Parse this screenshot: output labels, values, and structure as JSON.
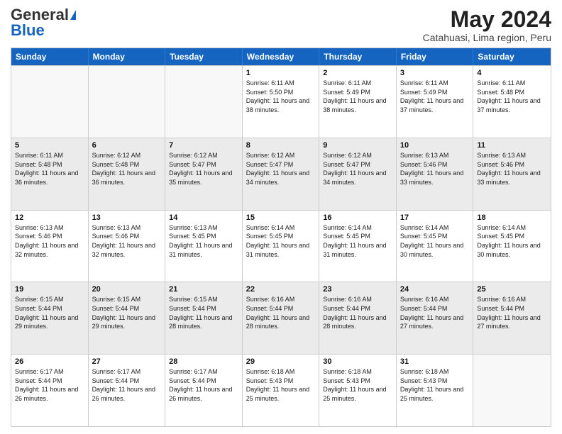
{
  "logo": {
    "general": "General",
    "blue": "Blue"
  },
  "title": "May 2024",
  "subtitle": "Catahuasi, Lima region, Peru",
  "days": [
    "Sunday",
    "Monday",
    "Tuesday",
    "Wednesday",
    "Thursday",
    "Friday",
    "Saturday"
  ],
  "weeks": [
    [
      {
        "day": "",
        "info": "",
        "empty": true
      },
      {
        "day": "",
        "info": "",
        "empty": true
      },
      {
        "day": "",
        "info": "",
        "empty": true
      },
      {
        "day": "1",
        "info": "Sunrise: 6:11 AM\nSunset: 5:50 PM\nDaylight: 11 hours and 38 minutes."
      },
      {
        "day": "2",
        "info": "Sunrise: 6:11 AM\nSunset: 5:49 PM\nDaylight: 11 hours and 38 minutes."
      },
      {
        "day": "3",
        "info": "Sunrise: 6:11 AM\nSunset: 5:49 PM\nDaylight: 11 hours and 37 minutes."
      },
      {
        "day": "4",
        "info": "Sunrise: 6:11 AM\nSunset: 5:48 PM\nDaylight: 11 hours and 37 minutes."
      }
    ],
    [
      {
        "day": "5",
        "info": "Sunrise: 6:11 AM\nSunset: 5:48 PM\nDaylight: 11 hours and 36 minutes."
      },
      {
        "day": "6",
        "info": "Sunrise: 6:12 AM\nSunset: 5:48 PM\nDaylight: 11 hours and 36 minutes."
      },
      {
        "day": "7",
        "info": "Sunrise: 6:12 AM\nSunset: 5:47 PM\nDaylight: 11 hours and 35 minutes."
      },
      {
        "day": "8",
        "info": "Sunrise: 6:12 AM\nSunset: 5:47 PM\nDaylight: 11 hours and 34 minutes."
      },
      {
        "day": "9",
        "info": "Sunrise: 6:12 AM\nSunset: 5:47 PM\nDaylight: 11 hours and 34 minutes."
      },
      {
        "day": "10",
        "info": "Sunrise: 6:13 AM\nSunset: 5:46 PM\nDaylight: 11 hours and 33 minutes."
      },
      {
        "day": "11",
        "info": "Sunrise: 6:13 AM\nSunset: 5:46 PM\nDaylight: 11 hours and 33 minutes."
      }
    ],
    [
      {
        "day": "12",
        "info": "Sunrise: 6:13 AM\nSunset: 5:46 PM\nDaylight: 11 hours and 32 minutes."
      },
      {
        "day": "13",
        "info": "Sunrise: 6:13 AM\nSunset: 5:46 PM\nDaylight: 11 hours and 32 minutes."
      },
      {
        "day": "14",
        "info": "Sunrise: 6:13 AM\nSunset: 5:45 PM\nDaylight: 11 hours and 31 minutes."
      },
      {
        "day": "15",
        "info": "Sunrise: 6:14 AM\nSunset: 5:45 PM\nDaylight: 11 hours and 31 minutes."
      },
      {
        "day": "16",
        "info": "Sunrise: 6:14 AM\nSunset: 5:45 PM\nDaylight: 11 hours and 31 minutes."
      },
      {
        "day": "17",
        "info": "Sunrise: 6:14 AM\nSunset: 5:45 PM\nDaylight: 11 hours and 30 minutes."
      },
      {
        "day": "18",
        "info": "Sunrise: 6:14 AM\nSunset: 5:45 PM\nDaylight: 11 hours and 30 minutes."
      }
    ],
    [
      {
        "day": "19",
        "info": "Sunrise: 6:15 AM\nSunset: 5:44 PM\nDaylight: 11 hours and 29 minutes."
      },
      {
        "day": "20",
        "info": "Sunrise: 6:15 AM\nSunset: 5:44 PM\nDaylight: 11 hours and 29 minutes."
      },
      {
        "day": "21",
        "info": "Sunrise: 6:15 AM\nSunset: 5:44 PM\nDaylight: 11 hours and 28 minutes."
      },
      {
        "day": "22",
        "info": "Sunrise: 6:16 AM\nSunset: 5:44 PM\nDaylight: 11 hours and 28 minutes."
      },
      {
        "day": "23",
        "info": "Sunrise: 6:16 AM\nSunset: 5:44 PM\nDaylight: 11 hours and 28 minutes."
      },
      {
        "day": "24",
        "info": "Sunrise: 6:16 AM\nSunset: 5:44 PM\nDaylight: 11 hours and 27 minutes."
      },
      {
        "day": "25",
        "info": "Sunrise: 6:16 AM\nSunset: 5:44 PM\nDaylight: 11 hours and 27 minutes."
      }
    ],
    [
      {
        "day": "26",
        "info": "Sunrise: 6:17 AM\nSunset: 5:44 PM\nDaylight: 11 hours and 26 minutes."
      },
      {
        "day": "27",
        "info": "Sunrise: 6:17 AM\nSunset: 5:44 PM\nDaylight: 11 hours and 26 minutes."
      },
      {
        "day": "28",
        "info": "Sunrise: 6:17 AM\nSunset: 5:44 PM\nDaylight: 11 hours and 26 minutes."
      },
      {
        "day": "29",
        "info": "Sunrise: 6:18 AM\nSunset: 5:43 PM\nDaylight: 11 hours and 25 minutes."
      },
      {
        "day": "30",
        "info": "Sunrise: 6:18 AM\nSunset: 5:43 PM\nDaylight: 11 hours and 25 minutes."
      },
      {
        "day": "31",
        "info": "Sunrise: 6:18 AM\nSunset: 5:43 PM\nDaylight: 11 hours and 25 minutes."
      },
      {
        "day": "",
        "info": "",
        "empty": true
      }
    ]
  ]
}
